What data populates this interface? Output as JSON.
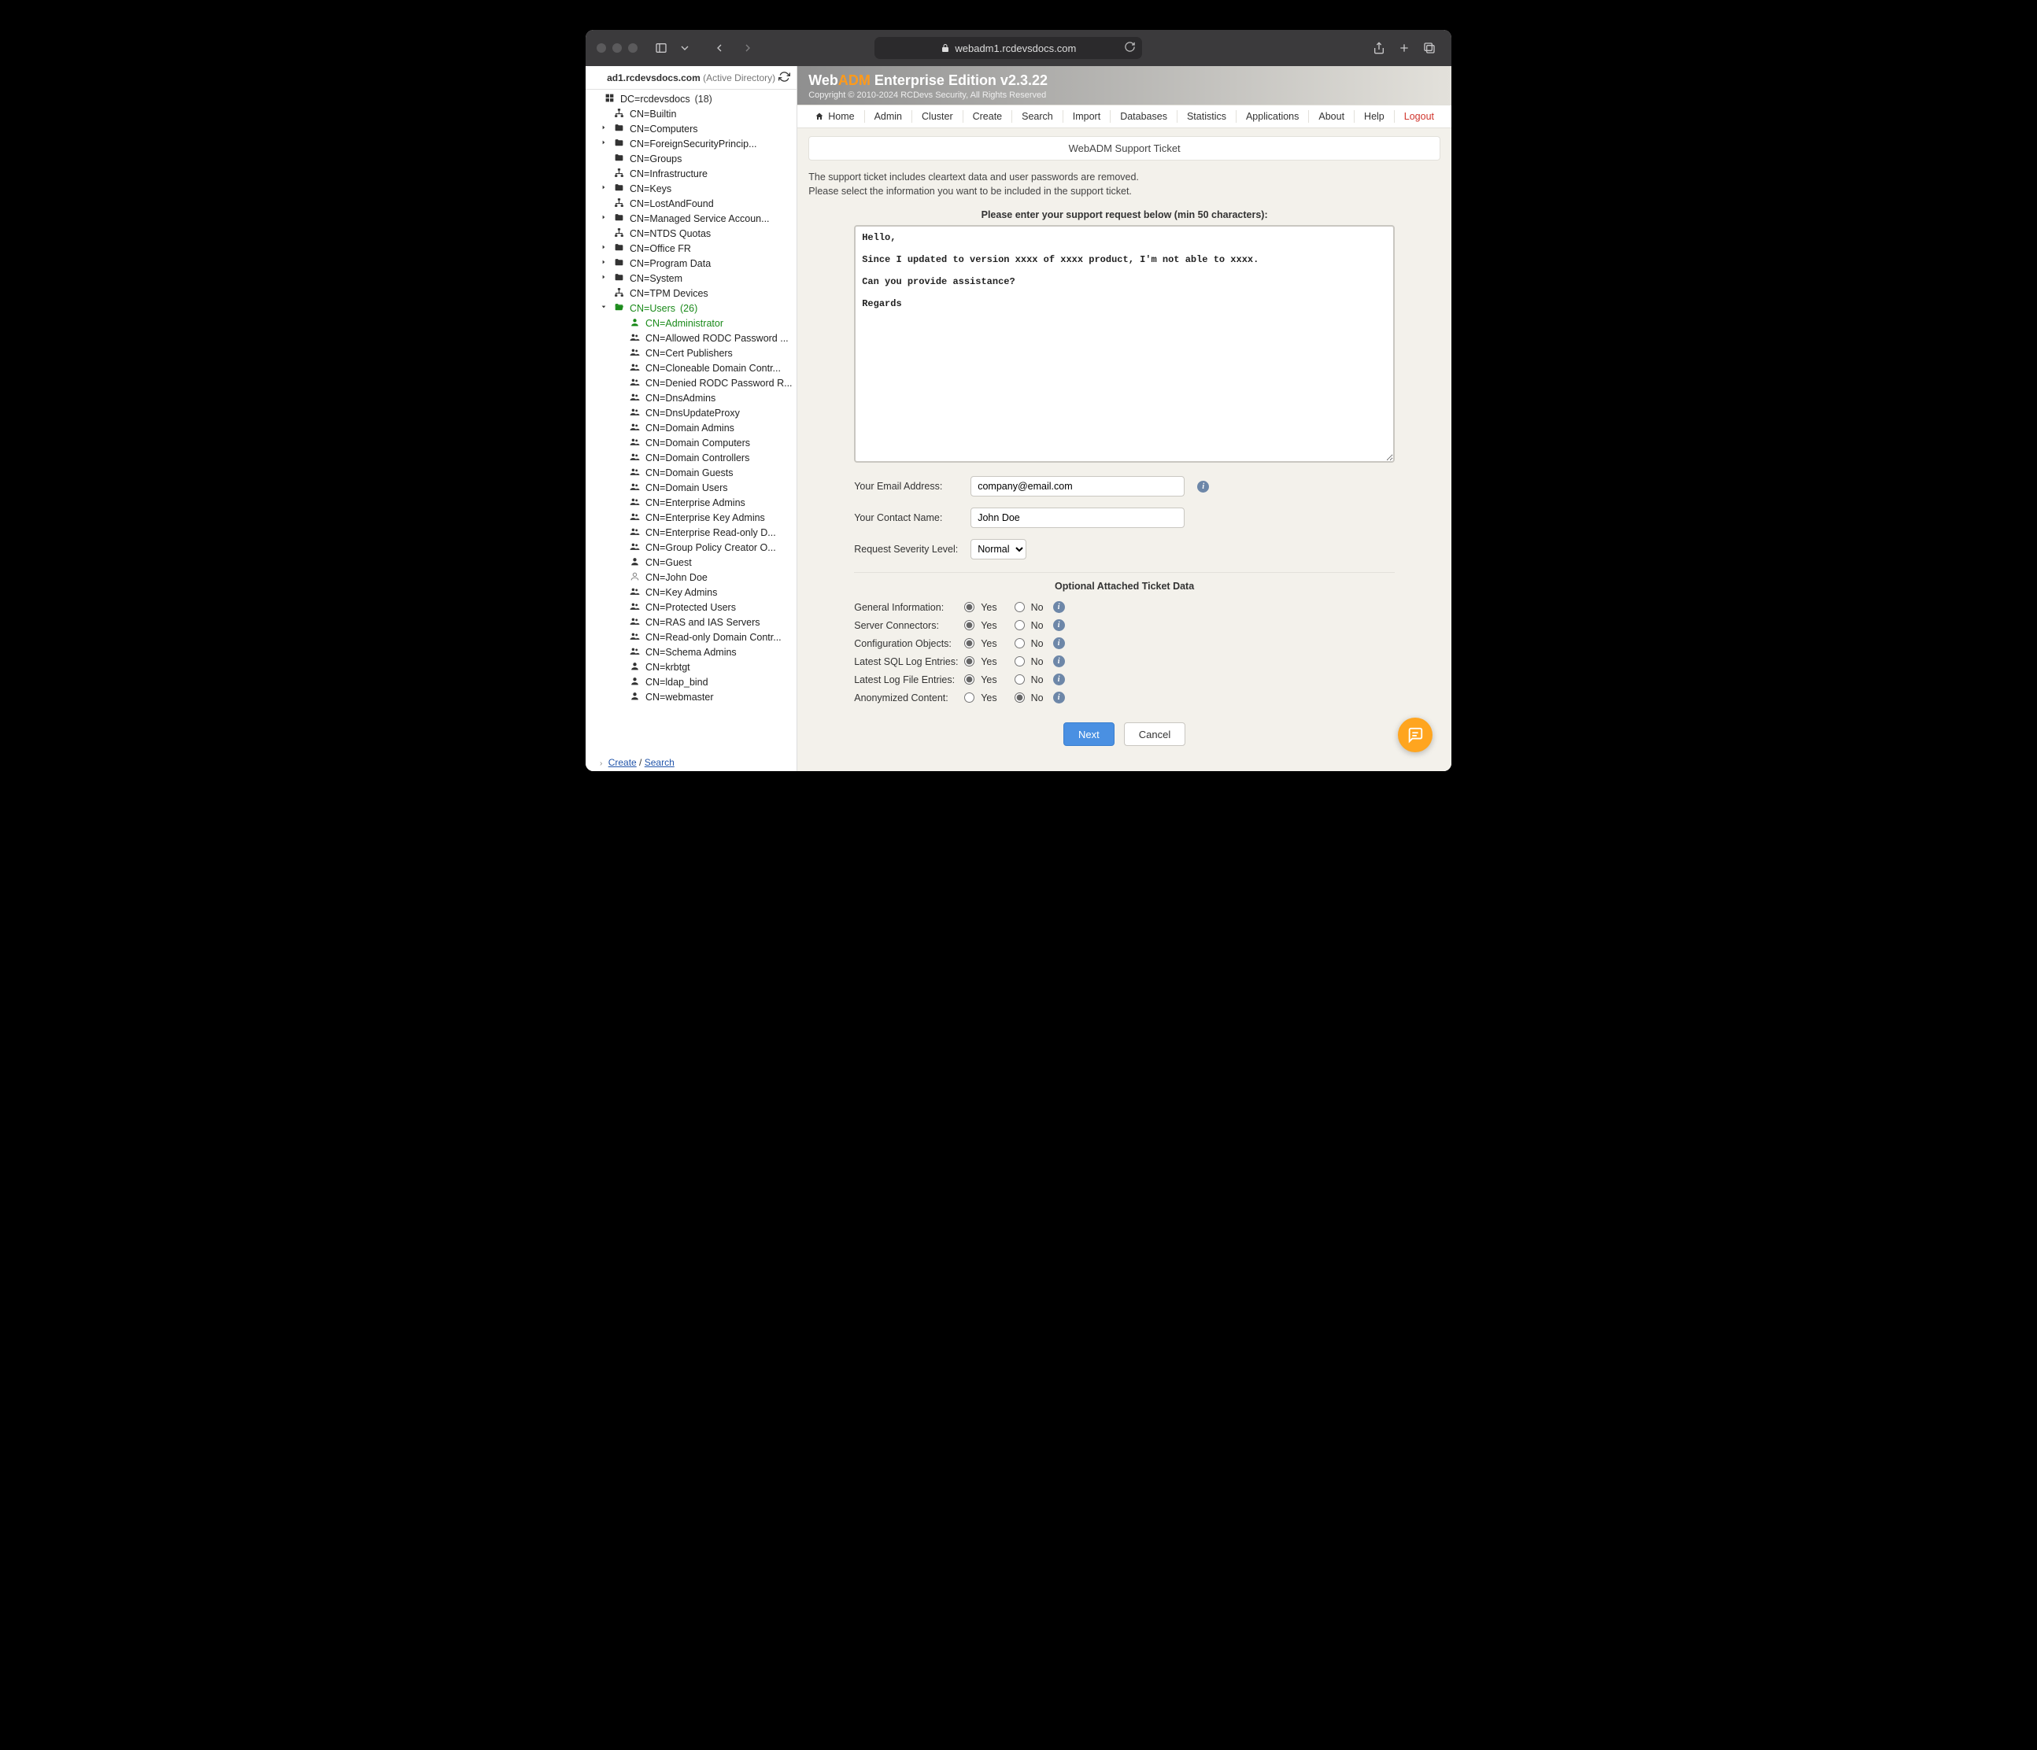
{
  "browser": {
    "url_display": "webadm1.rcdevsdocs.com"
  },
  "sidebar": {
    "header_domain": "ad1.rcdevsdocs.com",
    "header_type": "(Active Directory)",
    "root": {
      "label": "DC=rcdevsdocs",
      "count": "(18)"
    },
    "level1": [
      {
        "label": "CN=Builtin",
        "icon": "sitemap",
        "arrow": ""
      },
      {
        "label": "CN=Computers",
        "icon": "folder",
        "arrow": ">"
      },
      {
        "label": "CN=ForeignSecurityPrincip...",
        "icon": "folder",
        "arrow": ">"
      },
      {
        "label": "CN=Groups",
        "icon": "folder",
        "arrow": ""
      },
      {
        "label": "CN=Infrastructure",
        "icon": "sitemap",
        "arrow": ""
      },
      {
        "label": "CN=Keys",
        "icon": "folder",
        "arrow": ">"
      },
      {
        "label": "CN=LostAndFound",
        "icon": "sitemap",
        "arrow": ""
      },
      {
        "label": "CN=Managed Service Accoun...",
        "icon": "folder",
        "arrow": ">"
      },
      {
        "label": "CN=NTDS Quotas",
        "icon": "sitemap",
        "arrow": ""
      },
      {
        "label": "CN=Office FR",
        "icon": "folder",
        "arrow": ">"
      },
      {
        "label": "CN=Program Data",
        "icon": "folder",
        "arrow": ">"
      },
      {
        "label": "CN=System",
        "icon": "folder",
        "arrow": ">"
      },
      {
        "label": "CN=TPM Devices",
        "icon": "sitemap",
        "arrow": ""
      }
    ],
    "users_node": {
      "label": "CN=Users",
      "count": "(26)"
    },
    "users_children": [
      {
        "label": "CN=Administrator",
        "icon": "user",
        "green": true
      },
      {
        "label": "CN=Allowed RODC Password ...",
        "icon": "users"
      },
      {
        "label": "CN=Cert Publishers",
        "icon": "users"
      },
      {
        "label": "CN=Cloneable Domain Contr...",
        "icon": "users"
      },
      {
        "label": "CN=Denied RODC Password R...",
        "icon": "users"
      },
      {
        "label": "CN=DnsAdmins",
        "icon": "users"
      },
      {
        "label": "CN=DnsUpdateProxy",
        "icon": "users"
      },
      {
        "label": "CN=Domain Admins",
        "icon": "users"
      },
      {
        "label": "CN=Domain Computers",
        "icon": "users"
      },
      {
        "label": "CN=Domain Controllers",
        "icon": "users"
      },
      {
        "label": "CN=Domain Guests",
        "icon": "users"
      },
      {
        "label": "CN=Domain Users",
        "icon": "users"
      },
      {
        "label": "CN=Enterprise Admins",
        "icon": "users"
      },
      {
        "label": "CN=Enterprise Key Admins",
        "icon": "users"
      },
      {
        "label": "CN=Enterprise Read-only D...",
        "icon": "users"
      },
      {
        "label": "CN=Group Policy Creator O...",
        "icon": "users"
      },
      {
        "label": "CN=Guest",
        "icon": "user"
      },
      {
        "label": "CN=John Doe",
        "icon": "user-outline"
      },
      {
        "label": "CN=Key Admins",
        "icon": "users"
      },
      {
        "label": "CN=Protected Users",
        "icon": "users"
      },
      {
        "label": "CN=RAS and IAS Servers",
        "icon": "users"
      },
      {
        "label": "CN=Read-only Domain Contr...",
        "icon": "users"
      },
      {
        "label": "CN=Schema Admins",
        "icon": "users"
      },
      {
        "label": "CN=krbtgt",
        "icon": "user"
      },
      {
        "label": "CN=ldap_bind",
        "icon": "user"
      },
      {
        "label": "CN=webmaster",
        "icon": "user"
      }
    ],
    "footer": {
      "create": "Create",
      "sep": " / ",
      "search": "Search"
    }
  },
  "brand": {
    "prefix": "Web",
    "adm": "ADM",
    "suffix": " Enterprise Edition v2.3.22",
    "sub": "Copyright © 2010-2024 RCDevs Security, All Rights Reserved"
  },
  "nav": {
    "items": [
      "Home",
      "Admin",
      "Cluster",
      "Create",
      "Search",
      "Import",
      "Databases",
      "Statistics",
      "Applications",
      "About",
      "Help"
    ],
    "logout": "Logout"
  },
  "panel_title": "WebADM Support Ticket",
  "info_line1": "The support ticket includes cleartext data and user passwords are removed.",
  "info_line2": "Please select the information you want to be included in the support ticket.",
  "form": {
    "heading": "Please enter your support request below (min 50 characters):",
    "request_value": "Hello,\n\nSince I updated to version xxxx of xxxx product, I'm not able to xxxx.\n\nCan you provide assistance?\n\nRegards",
    "email_label": "Your Email Address:",
    "email_value": "company@email.com",
    "name_label": "Your Contact Name:",
    "name_value": "John Doe",
    "severity_label": "Request Severity Level:",
    "severity_value": "Normal"
  },
  "attached": {
    "heading": "Optional Attached Ticket Data",
    "yes": "Yes",
    "no": "No",
    "rows": [
      {
        "label": "General Information:",
        "value": "yes"
      },
      {
        "label": "Server Connectors:",
        "value": "yes"
      },
      {
        "label": "Configuration Objects:",
        "value": "yes"
      },
      {
        "label": "Latest SQL Log Entries:",
        "value": "yes"
      },
      {
        "label": "Latest Log File Entries:",
        "value": "yes"
      },
      {
        "label": "Anonymized Content:",
        "value": "no"
      }
    ]
  },
  "buttons": {
    "next": "Next",
    "cancel": "Cancel"
  }
}
